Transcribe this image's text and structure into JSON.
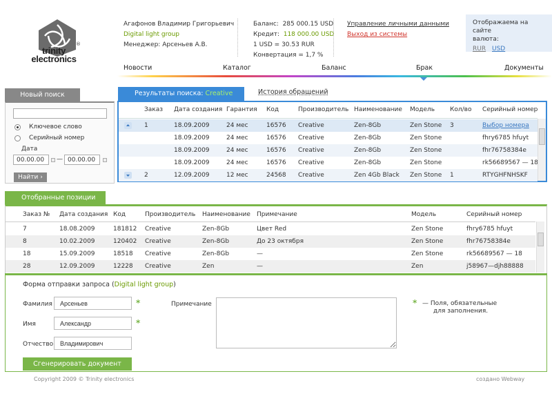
{
  "brand": {
    "line1": "trinity",
    "line2": "electronics",
    "registered": "®"
  },
  "user": {
    "name": "Агафонов Владимир Григорьевич",
    "company": "Digital light group",
    "manager": "Менеджер: Арсеньев А.В."
  },
  "balance": {
    "balance_label": "Баланс:",
    "balance_value": "285 000.15 USD",
    "credit_label": "Кредит:",
    "credit_value": "118 000.00 USD",
    "rate": "1 USD = 30.53 RUR",
    "conversion": "Конвертация = 1,7 %"
  },
  "account_links": {
    "manage": "Управление личными данными",
    "logout": "Выход из системы"
  },
  "currency": {
    "label_line1": "Отображаема на сайте",
    "label_line2": "валюта:",
    "options": [
      "RUR",
      "USD"
    ]
  },
  "nav": [
    "Новости",
    "Каталог",
    "Баланс",
    "Брак",
    "Документы"
  ],
  "search": {
    "tab": "Новый поиск",
    "query_value": "",
    "radio_keyword": "Ключевое слово",
    "radio_serial": "Серийный номер",
    "date_label": "Дата",
    "date_from": "00.00.00",
    "date_to": "00.00.00",
    "dash": "—",
    "find": "Найти",
    "find_arrow": "›"
  },
  "results": {
    "tab_label": "Результаты поиска:",
    "tab_query": "Creative",
    "history_tab": "История обращений",
    "columns": [
      "Заказ",
      "Дата создания",
      "Гарантия",
      "Код",
      "Производитель",
      "Наименование",
      "Модель",
      "Кол/во",
      "Серийный номер"
    ],
    "rows": [
      [
        "1",
        "18.09.2009",
        "24 мес",
        "16576",
        "Creative",
        "Zen-8Gb",
        "Zen Stone",
        "3",
        "Выбор номера"
      ],
      [
        "",
        "18.09.2009",
        "24 мес",
        "16576",
        "Creative",
        "Zen-8Gb",
        "Zen Stone",
        "",
        "fhry6785 hfuyt"
      ],
      [
        "",
        "18.09.2009",
        "24 мес",
        "16576",
        "Creative",
        "Zen-8Gb",
        "Zen Stone",
        "",
        "fhr76758384e"
      ],
      [
        "",
        "18.09.2009",
        "24 мес",
        "16576",
        "Creative",
        "Zen-8Gb",
        "Zen Stone",
        "",
        "rk56689567 — 18"
      ],
      [
        "2",
        "12.09.2009",
        "12 мес",
        "24568",
        "Creative",
        "Zen 4Gb Black",
        "Zen Stone",
        "1",
        "RTYGHFNHSKF"
      ]
    ]
  },
  "selected": {
    "tab": "Отобранные позиции",
    "columns": [
      "Заказ №",
      "Дата создания",
      "Код",
      "Производитель",
      "Наименование",
      "Примечание",
      "Модель",
      "Серийный номер"
    ],
    "rows": [
      [
        "7",
        "18.08.2009",
        "181812",
        "Creative",
        "Zen-8Gb",
        "Цвет Red",
        "Zen Stone",
        "fhry6785 hfuyt"
      ],
      [
        "8",
        "10.02.2009",
        "120402",
        "Creative",
        "Zen-8Gb",
        "До 23 октября",
        "Zen Stone",
        "fhr76758384e"
      ],
      [
        "18",
        "15.09.2009",
        "18518",
        "Creative",
        "Zen-8Gb",
        "—",
        "Zen Stone",
        "rk56689567 — 18"
      ],
      [
        "28",
        "12.09.2009",
        "12228",
        "Creative",
        "Zen",
        "—",
        "Zen",
        "j58967—djh88888"
      ]
    ]
  },
  "form": {
    "title": "Форма отправки запроса (",
    "title_group": "Digital light group",
    "title_end": ")",
    "surname_label": "Фамилия",
    "surname_value": "Арсеньев",
    "name_label": "Имя",
    "name_value": "Александр",
    "patronymic_label": "Отчество",
    "patronymic_value": "Владимирович",
    "note_label": "Примечание",
    "note_value": "",
    "required_star": "*",
    "required_line1": "—  Поля, обязательные",
    "required_line2": "для заполнения.",
    "submit": "Сгенерировать документ"
  },
  "footer": {
    "copyright": "Copyright 2009 © Trinity electronics",
    "credit": "создано Webway"
  }
}
